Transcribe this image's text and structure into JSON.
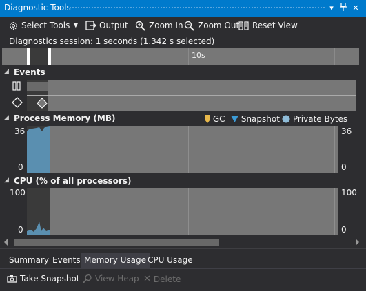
{
  "window": {
    "title": "Diagnostic Tools"
  },
  "toolbar": {
    "select_tools": "Select Tools",
    "output": "Output",
    "zoom_in": "Zoom In",
    "zoom_out": "Zoom Out",
    "reset_view": "Reset View"
  },
  "session": {
    "text": "Diagnostics session: 1 seconds (1.342 s selected)"
  },
  "ruler": {
    "tick_label": "10s"
  },
  "events": {
    "header": "Events"
  },
  "memory": {
    "header": "Process Memory (MB)",
    "legend": {
      "gc": "GC",
      "snapshot": "Snapshot",
      "private_bytes": "Private Bytes"
    },
    "y_max": "36",
    "y_min": "0"
  },
  "cpu": {
    "header": "CPU (% of all processors)",
    "y_max": "100",
    "y_min": "0"
  },
  "tabs": [
    "Summary",
    "Events",
    "Memory Usage",
    "CPU Usage"
  ],
  "active_tab": "Memory Usage",
  "actions": {
    "take_snapshot": "Take Snapshot",
    "view_heap": "View Heap",
    "delete": "Delete"
  },
  "colors": {
    "accent": "#007acc",
    "chart_fill": "#5a8fb0",
    "chart_background": "#777777",
    "gc_marker": "#e8b84b",
    "snapshot_marker": "#3c9bd6",
    "private_bytes_marker": "#8fbcd8"
  }
}
